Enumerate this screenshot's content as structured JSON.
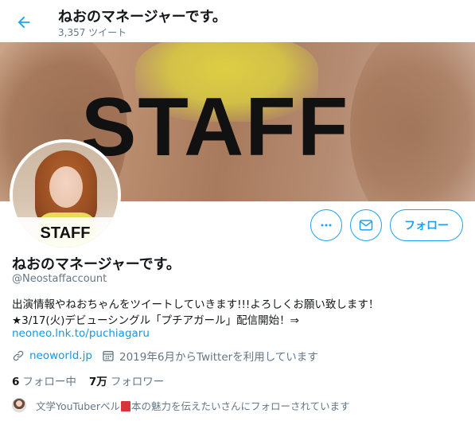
{
  "header": {
    "title": "ねおのマネージャーです。",
    "tweet_count": "3,357 ツイート",
    "back_icon": "arrow-left-icon"
  },
  "banner": {
    "text": "STAFF"
  },
  "avatar": {
    "label": "STAFF"
  },
  "actions": {
    "more_icon": "more-horizontal-icon",
    "message_icon": "envelope-icon",
    "follow_label": "フォロー"
  },
  "profile": {
    "name": "ねおのマネージャーです。",
    "handle": "@Neostaffaccount",
    "bio_line1": "出演情報やねおちゃんをツイートしていきます!!!よろしくお願い致します！",
    "bio_line2": "★3/17(火)デビューシングル「プチアガール」配信開始！⇒",
    "bio_link": "neoneo.lnk.to/puchiagaru",
    "website": "neoworld.jp",
    "joined": "2019年6月からTwitterを利用しています",
    "link_icon": "link-icon",
    "calendar_icon": "calendar-icon"
  },
  "stats": {
    "following_count": "6",
    "following_label": "フォロー中",
    "followers_count": "7万",
    "followers_label": "フォロワー"
  },
  "followed_by": {
    "text_before": "文学YouTuberベル",
    "text_after": "本の魅力を伝えたいさんにフォローされています",
    "book_emoji": "closed-book-icon"
  },
  "colors": {
    "accent": "#1da1f2",
    "link": "#1b95e0",
    "secondary_text": "#657786",
    "primary_text": "#14171a"
  }
}
